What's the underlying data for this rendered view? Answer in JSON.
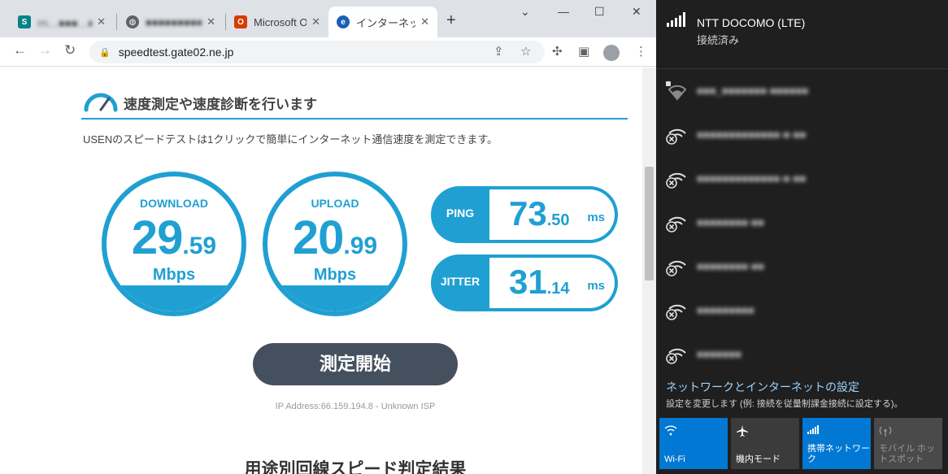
{
  "browser": {
    "tabs": [
      {
        "title": "ｍ…■■■…■…■…■",
        "icon": "sharepoint-icon"
      },
      {
        "title": "■■■■■■■■■■",
        "icon": "globe-icon"
      },
      {
        "title": "Microsoft Of",
        "icon": "office-icon"
      },
      {
        "title": "インターネット",
        "icon": "speedtest-icon"
      }
    ],
    "url": "speedtest.gate02.ne.jp"
  },
  "page": {
    "heading": "速度測定や速度診断を行います",
    "description": "USENのスピードテストは1クリックで簡単にインターネット通信速度を測定できます。",
    "download": {
      "label": "DOWNLOAD",
      "int": "29",
      "dec": ".59",
      "unit": "Mbps"
    },
    "upload": {
      "label": "UPLOAD",
      "int": "20",
      "dec": ".99",
      "unit": "Mbps"
    },
    "ping": {
      "label": "PING",
      "int": "73",
      "dec": ".50",
      "unit": "ms"
    },
    "jitter": {
      "label": "JITTER",
      "int": "31",
      "dec": ".14",
      "unit": "ms"
    },
    "start_button": "測定開始",
    "ip_info": "IP Address:66.159.194.8 - Unknown ISP",
    "result_heading": "用途別回線スピード判定結果"
  },
  "network": {
    "current": {
      "name": "NTT DOCOMO (LTE)",
      "status": "接続済み"
    },
    "wifi_list": [
      {
        "name": "■■■_■■■■■■■-■■■■■■",
        "secured": true
      },
      {
        "name": "■■■■■■■■■■■■■-■-■■",
        "secured": false
      },
      {
        "name": "■■■■■■■■■■■■■-■-■■",
        "secured": false
      },
      {
        "name": "■■■■■■■■-■■",
        "secured": false
      },
      {
        "name": "■■■■■■■■-■■",
        "secured": false
      },
      {
        "name": "■■■■■■■■■",
        "secured": false
      },
      {
        "name": "■■■■■■■",
        "secured": false
      }
    ],
    "settings_link": "ネットワークとインターネットの設定",
    "settings_desc": "設定を変更します (例: 接続を従量制課金接続に設定する)。",
    "quick_actions": [
      {
        "label": "Wi-Fi",
        "active": true,
        "icon": "wifi-icon"
      },
      {
        "label": "機内モード",
        "active": false,
        "icon": "airplane-icon"
      },
      {
        "label": "携帯ネットワーク",
        "active": true,
        "icon": "cellular-icon"
      },
      {
        "label": "モバイル ホットスポット",
        "active": false,
        "disabled": true,
        "icon": "hotspot-icon"
      }
    ]
  },
  "colors": {
    "accent": "#20a0d2",
    "button_dark": "#45505e",
    "flyout_bg": "#1f1f1f",
    "tile_active": "#0078d4"
  }
}
